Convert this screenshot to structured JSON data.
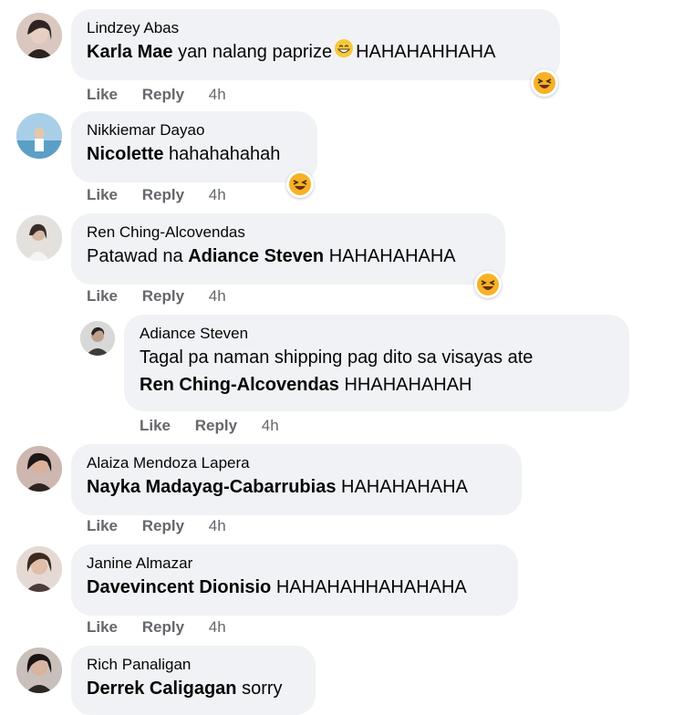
{
  "comments": [
    {
      "author": "Lindzey Abas",
      "tag": "Karla Mae",
      "text": "yan nalang paprize",
      "text_after": "HAHAHAHHAHA",
      "actions": {
        "like": "Like",
        "reply": "Reply",
        "time": "4h"
      }
    },
    {
      "author": "Nikkiemar Dayao",
      "tag": "Nicolette",
      "text": "hahahahahah",
      "actions": {
        "like": "Like",
        "reply": "Reply",
        "time": "4h"
      }
    },
    {
      "author": "Ren Ching-Alcovendas",
      "prefix": "Patawad na",
      "tag": "Adiance Steven",
      "text": "HAHAHAHAHA",
      "actions": {
        "like": "Like",
        "reply": "Reply",
        "time": "4h"
      },
      "reply": {
        "author": "Adiance Steven",
        "line1": "Tagal pa naman shipping pag dito sa visayas ate",
        "tag": "Ren Ching-Alcovendas",
        "text": "HHAHAHAHAH",
        "actions": {
          "like": "Like",
          "reply": "Reply",
          "time": "4h"
        }
      }
    },
    {
      "author": "Alaiza Mendoza Lapera",
      "tag": "Nayka Madayag-Cabarrubias",
      "text": "HAHAHAHAHA",
      "actions": {
        "like": "Like",
        "reply": "Reply",
        "time": "4h"
      }
    },
    {
      "author": "Janine Almazar",
      "tag": "Davevincent Dionisio",
      "text": "HAHAHAHHAHAHAHA",
      "actions": {
        "like": "Like",
        "reply": "Reply",
        "time": "4h"
      }
    },
    {
      "author": "Rich Panaligan",
      "tag": "Derrek Caligagan",
      "text": "sorry"
    }
  ],
  "icons": {
    "reaction": "haha-reaction-icon",
    "inline_emoji": "grinning-squint-emoji-icon"
  },
  "colors": {
    "bubble": "#f0f2f5",
    "meta_text": "#65676b",
    "haha_yellow": "#f7b125"
  }
}
